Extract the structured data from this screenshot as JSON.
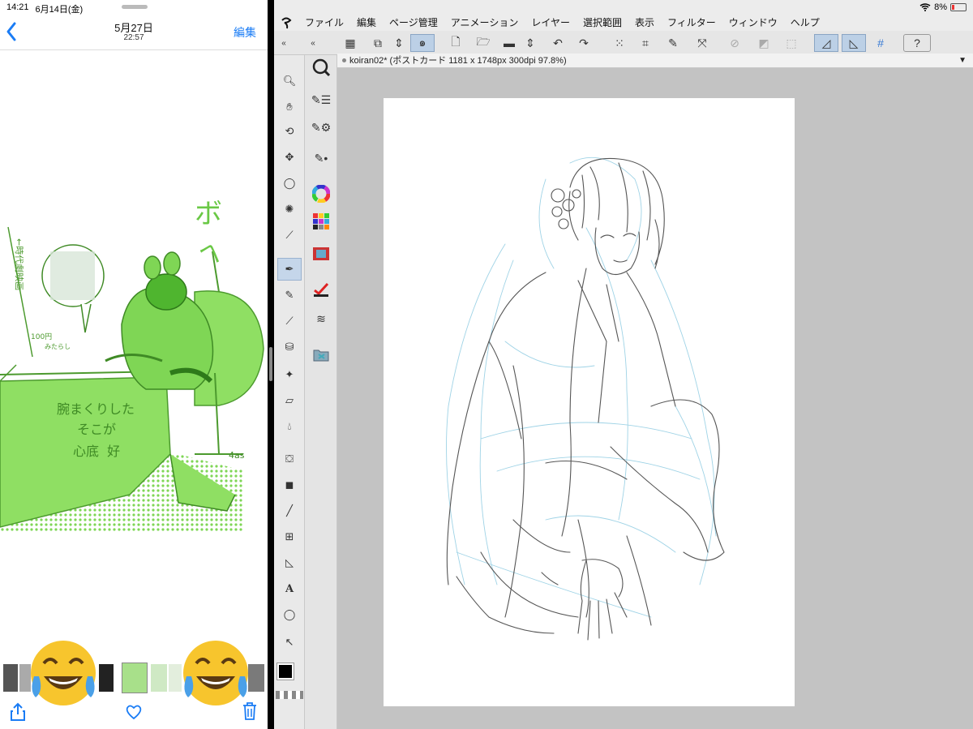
{
  "left_pane": {
    "status_time": "14:21",
    "status_date": "6月14日(金)",
    "nav": {
      "title": "5月27日",
      "subtitle": "22:57",
      "edit_label": "編集"
    },
    "photo_text": {
      "bo": "ボ",
      "he": "ヘ",
      "jidaigeki": "←時代劇映画",
      "coin": "100円",
      "coin_sub": "みたらし",
      "rolled": "腕まくりした",
      "soko": "そこが",
      "soko2": "心底 ︎ 好",
      "sign": "4as"
    }
  },
  "right_pane": {
    "status_battery": "8%",
    "menu": [
      "ファイル",
      "編集",
      "ページ管理",
      "アニメーション",
      "レイヤー",
      "選択範囲",
      "表示",
      "フィルター",
      "ウィンドウ",
      "ヘルプ"
    ],
    "doc_tab": "koiran02* (ポストカード 1181 x 1748px 300dpi 97.8%)"
  },
  "colors": {
    "accent_blue": "#1a7cf5",
    "photo_green": "#7fd655",
    "canvas_bg": "#c3c3c3"
  },
  "icons": {
    "toolbar": [
      "grid-icon",
      "copy-icon",
      "updown-icon",
      "swirl-icon",
      "new-doc-icon",
      "open-folder-icon",
      "save-icon",
      "updown2-icon",
      "undo-icon",
      "redo-icon",
      "scatter-icon",
      "crop-icon",
      "pen-mask-icon",
      "transform-icon",
      "deselect-icon",
      "invert-icon",
      "dotted-select-icon",
      "ruler-icon",
      "ruler2-icon",
      "grid-snap-icon",
      "help-icon"
    ],
    "tools": [
      "zoom-icon",
      "hand-icon",
      "rotate-icon",
      "move-icon",
      "lasso-icon",
      "magic-wand-icon",
      "eyedropper-icon",
      "pen-icon",
      "pencil-icon",
      "brush-icon",
      "airbrush-icon",
      "decoration-icon",
      "eraser-icon",
      "blend-icon",
      "fill-icon",
      "gradient-icon",
      "line-icon",
      "frame-icon",
      "ruler-tool-icon",
      "text-icon",
      "balloon-icon",
      "object-icon"
    ]
  }
}
